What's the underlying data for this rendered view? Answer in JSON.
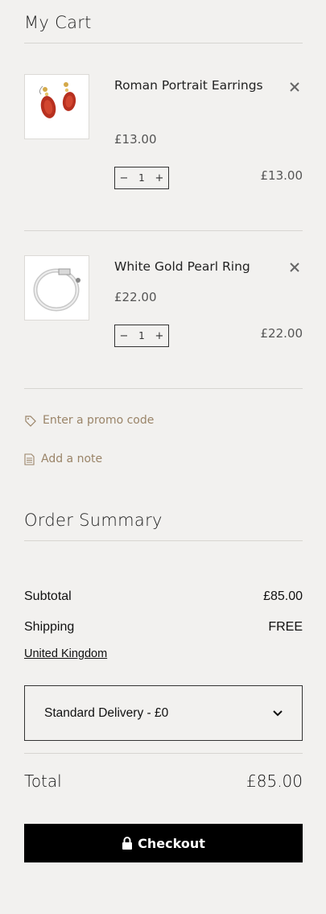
{
  "cart": {
    "title": "My Cart",
    "items": [
      {
        "name": "Roman Portrait Earrings",
        "unit_price": "£13.00",
        "quantity": "1",
        "line_total": "£13.00",
        "minus": "−",
        "plus": "+"
      },
      {
        "name": "White Gold Pearl Ring",
        "unit_price": "£22.00",
        "quantity": "1",
        "line_total": "£22.00",
        "minus": "−",
        "plus": "+"
      }
    ],
    "promo_label": "Enter a promo code",
    "note_label": "Add a note"
  },
  "summary": {
    "title": "Order Summary",
    "subtotal_label": "Subtotal",
    "subtotal_value": "£85.00",
    "shipping_label": "Shipping",
    "shipping_value": "FREE",
    "country": "United Kingdom",
    "delivery_option": "Standard Delivery - £0",
    "total_label": "Total",
    "total_value": "£85.00",
    "checkout_label": "Checkout"
  },
  "colors": {
    "background": "#f2f1ef",
    "link": "#9a8468",
    "button": "#000000"
  }
}
